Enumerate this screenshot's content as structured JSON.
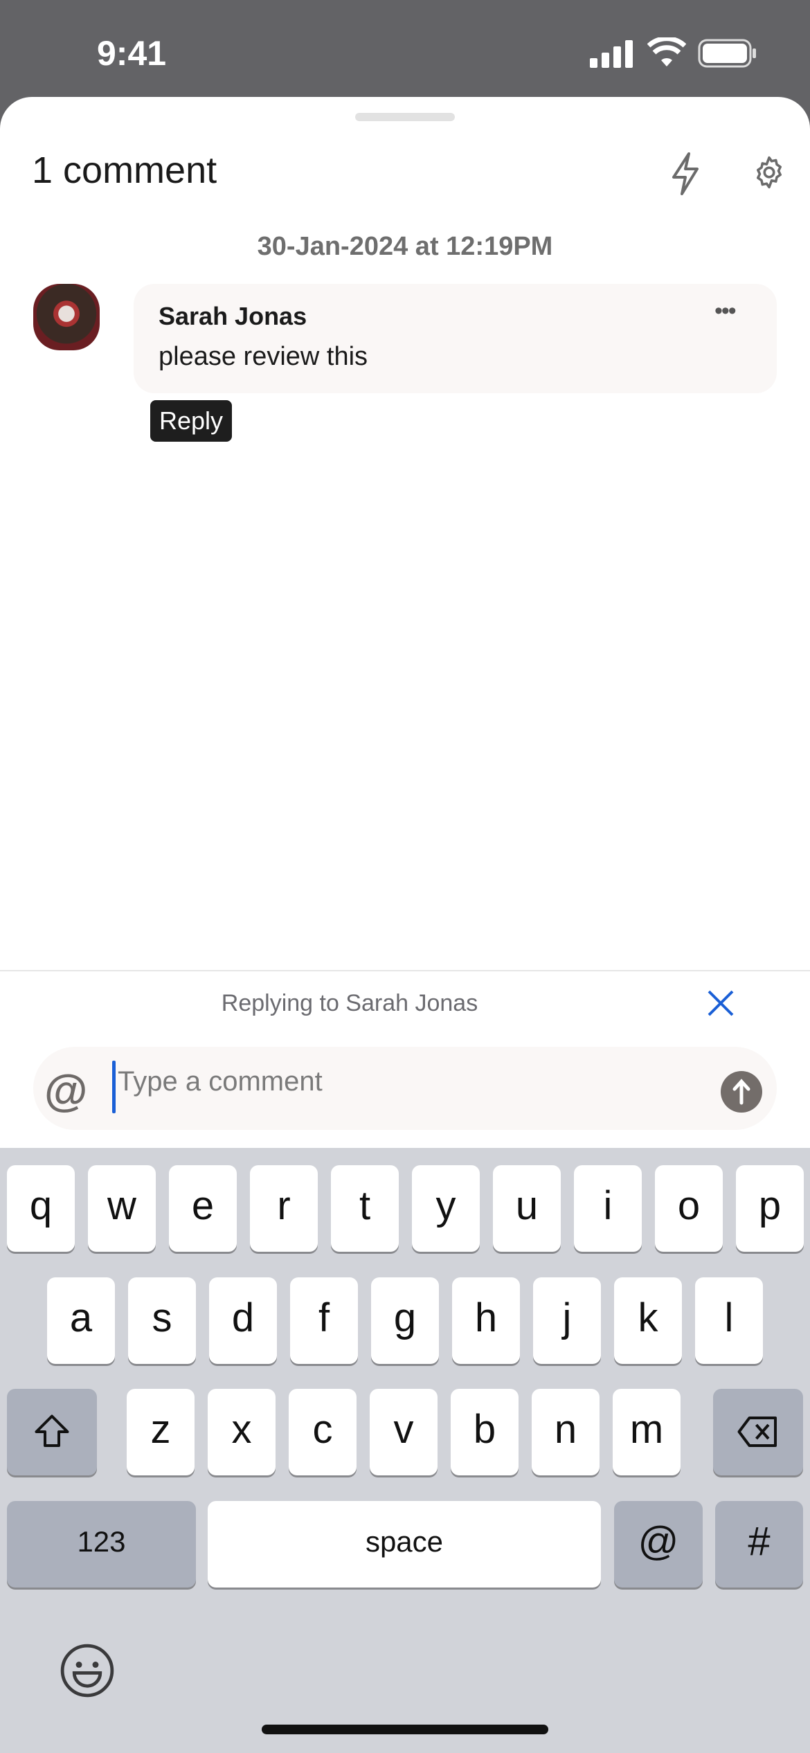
{
  "status_bar": {
    "time": "9:41"
  },
  "header": {
    "title": "1 comment",
    "icons": [
      "lightning-icon",
      "gear-icon"
    ]
  },
  "thread": {
    "date": "30-Jan-2024 at 12:19PM",
    "comment": {
      "author": "Sarah Jonas",
      "text": "please review this",
      "more_icon": "ellipsis-icon",
      "more_label": "•••"
    },
    "tooltip": "Reply"
  },
  "composer": {
    "replying_to": "Replying to Sarah Jonas",
    "mention_symbol": "@",
    "placeholder": "Type a comment",
    "close_icon": "close-icon",
    "send_icon": "arrow-up-icon"
  },
  "keyboard": {
    "row1": [
      "q",
      "w",
      "e",
      "r",
      "t",
      "y",
      "u",
      "i",
      "o",
      "p"
    ],
    "row2": [
      "a",
      "s",
      "d",
      "f",
      "g",
      "h",
      "j",
      "k",
      "l"
    ],
    "row3": [
      "z",
      "x",
      "c",
      "v",
      "b",
      "n",
      "m"
    ],
    "numbers": "123",
    "space": "space",
    "at": "@",
    "hash": "#"
  },
  "colors": {
    "accent": "#1a5fd6",
    "status_bar": "#636366",
    "keyboard_bg": "#d1d3d9"
  }
}
